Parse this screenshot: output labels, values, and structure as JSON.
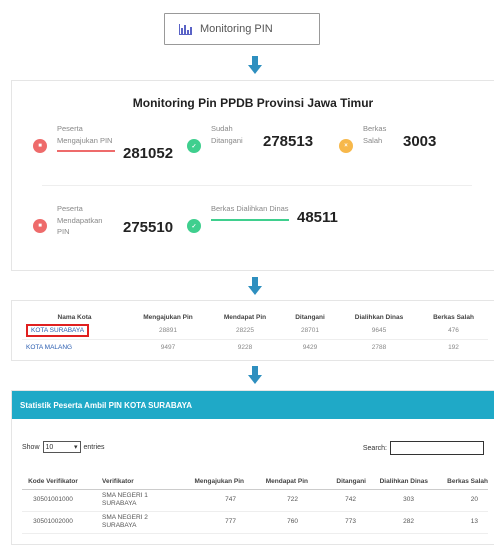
{
  "menu": {
    "label": "Monitoring PIN",
    "icon": "bar-chart-icon"
  },
  "dashboard": {
    "title": "Monitoring Pin PPDB Provinsi Jawa Timur",
    "stats_row1": [
      {
        "label": "Peserta Mengajukan PIN",
        "value": "281052",
        "color": "#ee6b6b",
        "icon": "trash-icon"
      },
      {
        "label": "Sudah Ditangani",
        "value": "278513",
        "color": "#3fcf8e",
        "icon": "check-icon"
      },
      {
        "label": "Berkas Salah",
        "value": "3003",
        "color": "#f7b84b",
        "icon": "x-icon"
      }
    ],
    "stats_row2": [
      {
        "label": "Peserta Mendapatkan PIN",
        "value": "275510",
        "color": "#ee6b6b",
        "icon": "trash-icon"
      },
      {
        "label": "Berkas Dialihkan Dinas",
        "value": "48511",
        "color": "#3fcf8e",
        "icon": "check-icon"
      }
    ]
  },
  "city_table": {
    "headers": [
      "Nama Kota",
      "Mengajukan Pin",
      "Mendapat Pin",
      "Ditangani",
      "Dialihkan Dinas",
      "Berkas Salah"
    ],
    "rows": [
      [
        "KOTA SURABAYA",
        "28891",
        "28225",
        "28701",
        "9645",
        "476"
      ],
      [
        "KOTA MALANG",
        "9497",
        "9228",
        "9429",
        "2788",
        "192"
      ]
    ]
  },
  "stats_table": {
    "title": "Statistik Peserta Ambil PIN KOTA SURABAYA",
    "show_label": "Show",
    "entries_value": "10",
    "entries_label": "entries",
    "search_label": "Search:",
    "headers": [
      "Kode Verifikator",
      "Verifikator",
      "Mengajukan Pin",
      "Mendapat Pin",
      "Ditangani",
      "Dialihkan Dinas",
      "Berkas Salah"
    ],
    "rows": [
      [
        "30501001000",
        "SMA NEGERI 1 SURABAYA",
        "747",
        "722",
        "742",
        "303",
        "20"
      ],
      [
        "30501002000",
        "SMA NEGERI 2 SURABAYA",
        "777",
        "760",
        "773",
        "282",
        "13"
      ]
    ]
  }
}
